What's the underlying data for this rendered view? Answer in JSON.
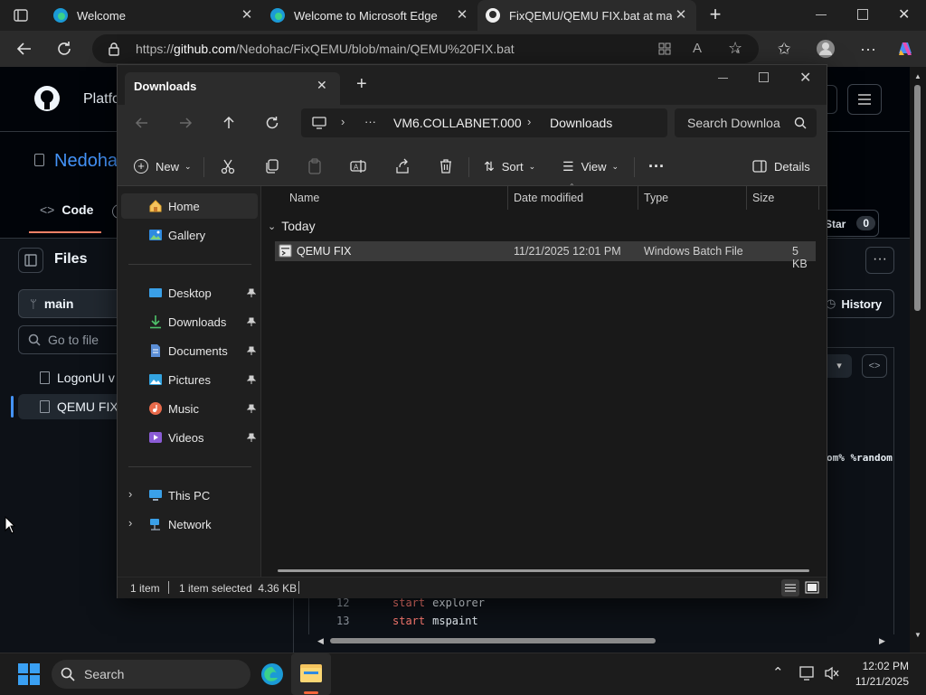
{
  "browser": {
    "tabs": [
      {
        "label": "Welcome"
      },
      {
        "label": "Welcome to Microsoft Edge"
      },
      {
        "label": "FixQEMU/QEMU FIX.bat at main"
      }
    ],
    "url_prefix": "https://",
    "url_domain": "github.com",
    "url_path": "/Nedohac/FixQEMU/blob/main/QEMU%20FIX.bat"
  },
  "github": {
    "nav_platform": "Platfo",
    "repo_owner": "Nedoha",
    "tab_code": "Code",
    "star_label": "Star",
    "star_count": "0",
    "files_heading": "Files",
    "branch": "main",
    "go_to_file": "Go to file",
    "file_items": [
      {
        "label": "LogonUI v"
      },
      {
        "label": "QEMU FIX"
      }
    ],
    "history_label": "History",
    "code_fragment": "om% %random",
    "code_lines": [
      {
        "num": "12",
        "cmd": "start",
        "arg": "explorer"
      },
      {
        "num": "13",
        "cmd": "start",
        "arg": "mspaint"
      }
    ]
  },
  "explorer": {
    "tab_title": "Downloads",
    "breadcrumb": [
      "VM6.COLLABNET.000",
      "Downloads"
    ],
    "breadcrumb_ellipsis": "···",
    "search_placeholder": "Search Downloa",
    "toolbar": {
      "new_label": "New",
      "sort_label": "Sort",
      "view_label": "View",
      "details_label": "Details"
    },
    "sidebar": {
      "top": [
        {
          "label": "Home",
          "icon": "home-icon"
        },
        {
          "label": "Gallery",
          "icon": "gallery-icon"
        }
      ],
      "pinned": [
        {
          "label": "Desktop",
          "icon": "desktop-icon"
        },
        {
          "label": "Downloads",
          "icon": "downloads-icon"
        },
        {
          "label": "Documents",
          "icon": "documents-icon"
        },
        {
          "label": "Pictures",
          "icon": "pictures-icon"
        },
        {
          "label": "Music",
          "icon": "music-icon"
        },
        {
          "label": "Videos",
          "icon": "videos-icon"
        }
      ],
      "bottom": [
        {
          "label": "This PC",
          "icon": "this-pc-icon"
        },
        {
          "label": "Network",
          "icon": "network-icon"
        }
      ]
    },
    "columns": [
      "Name",
      "Date modified",
      "Type",
      "Size"
    ],
    "group_header": "Today",
    "files": [
      {
        "name": "QEMU FIX",
        "date": "11/21/2025 12:01 PM",
        "type": "Windows Batch File",
        "size": "5 KB"
      }
    ],
    "status": {
      "count": "1 item",
      "selected": "1 item selected  4.36 KB"
    }
  },
  "taskbar": {
    "search_label": "Search",
    "time": "12:02 PM",
    "date": "11/21/2025"
  },
  "colors": {
    "github_blue": "#4493f8",
    "selection": "#3a3a3a",
    "accent": "#0078d4"
  }
}
